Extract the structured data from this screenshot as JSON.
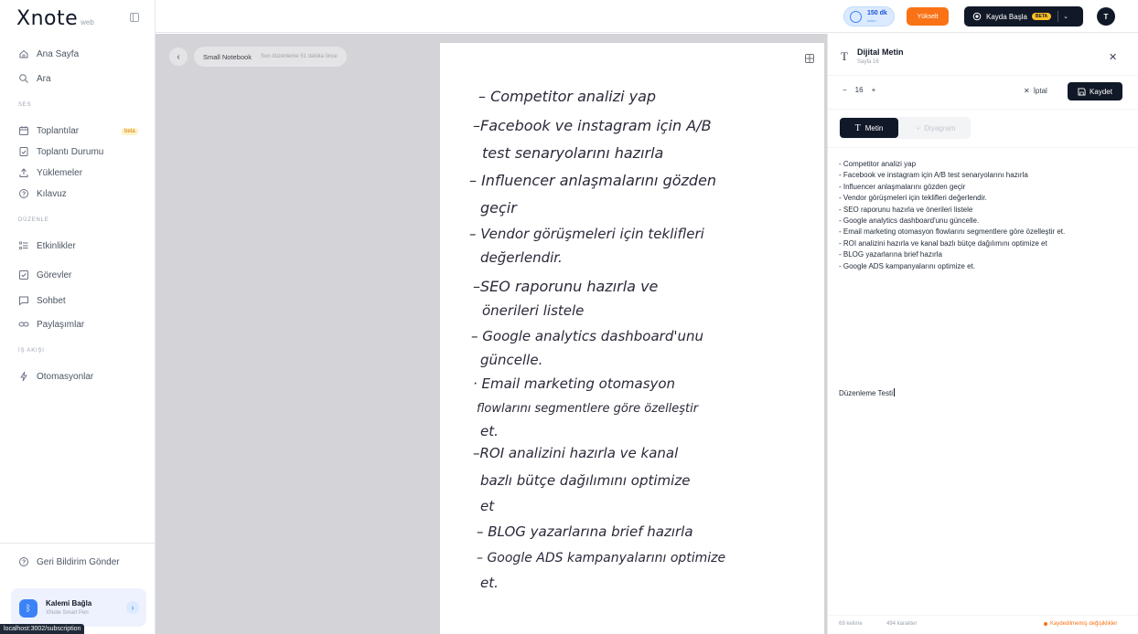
{
  "app": {
    "brand": "Xnote",
    "brand_sub": "web"
  },
  "sidebar": {
    "items_main": [
      {
        "label": "Ana Sayfa",
        "icon": "home-icon"
      },
      {
        "label": "Ara",
        "icon": "search-icon"
      }
    ],
    "section_ses": "SES",
    "items_ses": [
      {
        "label": "Toplantılar",
        "icon": "calendar-icon",
        "badge": "beta"
      },
      {
        "label": "Toplantı Durumu",
        "icon": "meeting-status-icon"
      },
      {
        "label": "Yüklemeler",
        "icon": "upload-icon"
      },
      {
        "label": "Kılavuz",
        "icon": "help-icon"
      }
    ],
    "section_duzenle": "DÜZENLE",
    "items_duzenle": [
      {
        "label": "Etkinlikler",
        "icon": "list-icon"
      },
      {
        "label": "Görevler",
        "icon": "checkbox-icon"
      },
      {
        "label": "Sohbet",
        "icon": "chat-icon"
      },
      {
        "label": "Paylaşımlar",
        "icon": "link-icon"
      }
    ],
    "section_is_akisi": "İŞ AKIŞI",
    "items_is_akisi": [
      {
        "label": "Otomasyonlar",
        "icon": "lightning-icon"
      }
    ],
    "feedback": "Geri Bildirim Gönder",
    "pen_card": {
      "title": "Kalemi Bağla",
      "subtitle": "XNote Smart Pen"
    },
    "status_url": "localhost:3002/subscription"
  },
  "topbar": {
    "credit_value": "150 dk",
    "credit_label": "kalan",
    "upgrade": "Yükselt",
    "record": "Kayda Başla",
    "record_badge": "BETA",
    "avatar": "T"
  },
  "canvas": {
    "notebook": "Small Notebook",
    "last_edit": "Son düzenleme 51 dakika önce",
    "handwriting": [
      "– Competitor analizi yap",
      "–Facebook ve instagram için A/B",
      "test senaryolarını hazırla",
      "– Influencer anlaşmalarını gözden",
      "geçir",
      "– Vendor görüşmeleri için teklifleri",
      "değerlendir.",
      "–SEO raporunu hazırla ve",
      "önerileri listele",
      "– Google analytics dashboard'unu",
      "güncelle.",
      "· Email marketing otomasyon",
      "flowlarını segmentlere göre özelleştir",
      "et.",
      "–ROI analizini hazırla ve kanal",
      "bazlı bütçe dağılımını optimize",
      "et",
      "– BLOG yazarlarına brief hazırla",
      "– Google ADS kampanyalarını optimize",
      "et."
    ]
  },
  "panel": {
    "title": "Dijital Metin",
    "subtitle": "Sayfa 16",
    "font_size": "16",
    "minus": "−",
    "plus": "+",
    "cancel": "İptal",
    "save": "Kaydet",
    "tab_text": "Metin",
    "tab_diagram": "Diyagram",
    "lines": [
      "- Competitor analizi yap",
      "- Facebook ve instagram için A/B test senaryolarını hazırla",
      "- Influencer anlaşmalarını gözden geçir",
      "- Vendor görüşmeleri için teklifleri değerlendir.",
      "- SEO raporunu hazırla ve önerileri listele",
      "- Google analytics dashboard'unu güncelle.",
      "- Email marketing otomasyon flowlarını segmentlere göre özelleştir et.",
      "- ROI analizini hazırla ve kanal bazlı bütçe dağılımını optimize et",
      "- BLOG yazarlarına brief hazırla",
      "- Google ADS kampanyalarını optimize et."
    ],
    "test_text": "Düzenleme Testi",
    "word_count": "69 kelime",
    "char_count": "494 karakter",
    "unsaved": "Kaydedilmemiş değişiklikler"
  },
  "colors": {
    "accent": "#111827",
    "upgrade": "#f97316",
    "credit": "#3b82f6",
    "canvas_bg": "#d4d4d8"
  }
}
